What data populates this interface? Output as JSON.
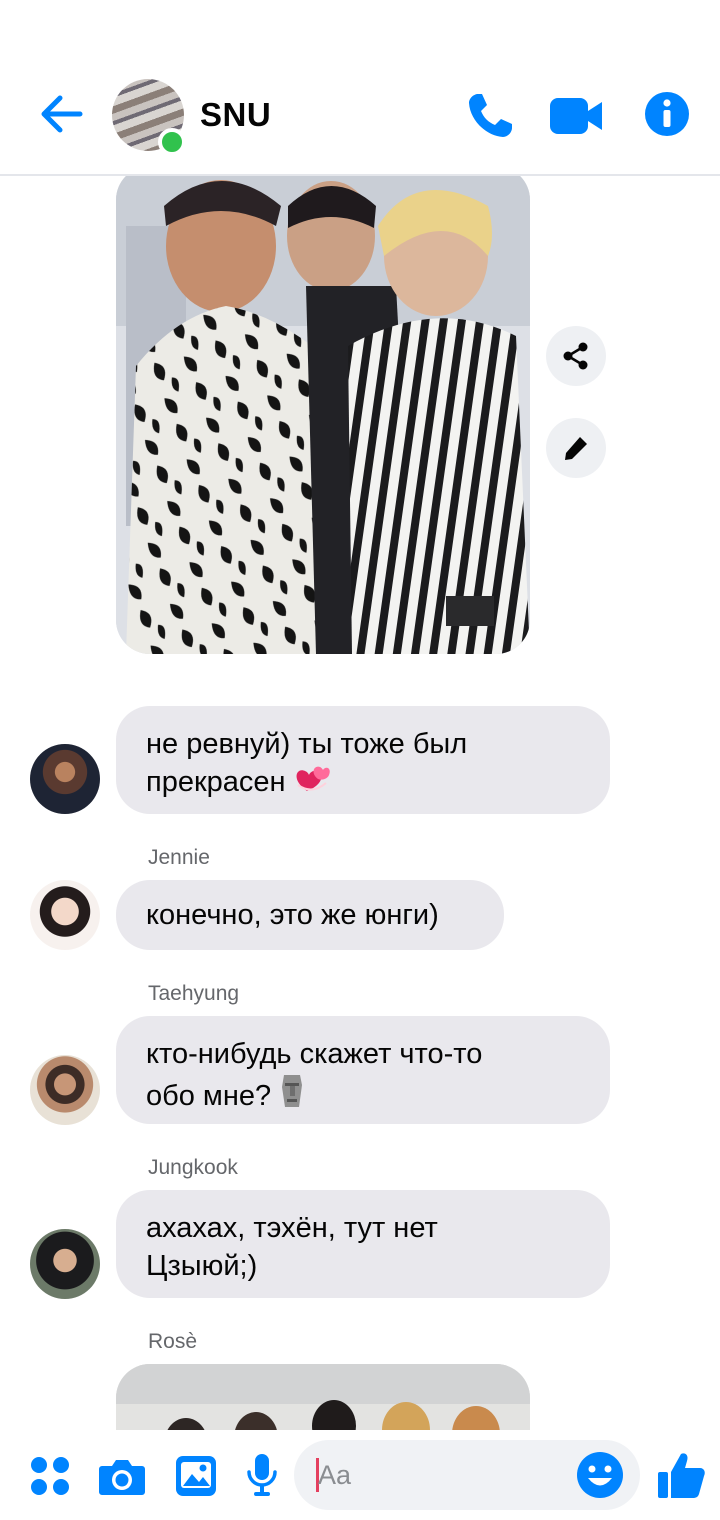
{
  "header": {
    "title": "SNU",
    "status": "online",
    "icons": [
      "back-arrow-icon",
      "phone-icon",
      "video-camera-icon",
      "info-icon"
    ]
  },
  "messages": [
    {
      "type": "image",
      "description_icon": "photo",
      "actions": [
        "share-icon",
        "edit-pencil-icon"
      ]
    },
    {
      "type": "text",
      "sender": "",
      "lines": [
        "не ревнуй) ты тоже был",
        "прекрасен"
      ],
      "emoji": "two-hearts"
    },
    {
      "type": "text",
      "sender": "Jennie",
      "lines": [
        "конечно, это же юнги)"
      ]
    },
    {
      "type": "text",
      "sender": "Taehyung",
      "lines": [
        "кто-нибудь скажет что-то",
        "обо мне?"
      ],
      "emoji": "moai"
    },
    {
      "type": "text",
      "sender": "Jungkook",
      "lines": [
        "ахахах, тэхён, тут нет",
        "Цзыюй;)"
      ]
    },
    {
      "type": "image",
      "sender": "Rosè"
    }
  ],
  "composer": {
    "placeholder": "Aa",
    "value": "",
    "icons": [
      "menu-dots-icon",
      "camera-icon",
      "gallery-icon",
      "microphone-icon",
      "emoji-icon",
      "like-thumb-icon"
    ]
  },
  "colors": {
    "accent": "#0084ff",
    "bubble": "#e9e8ed",
    "online": "#31c24d",
    "sender_label": "#65676b"
  }
}
